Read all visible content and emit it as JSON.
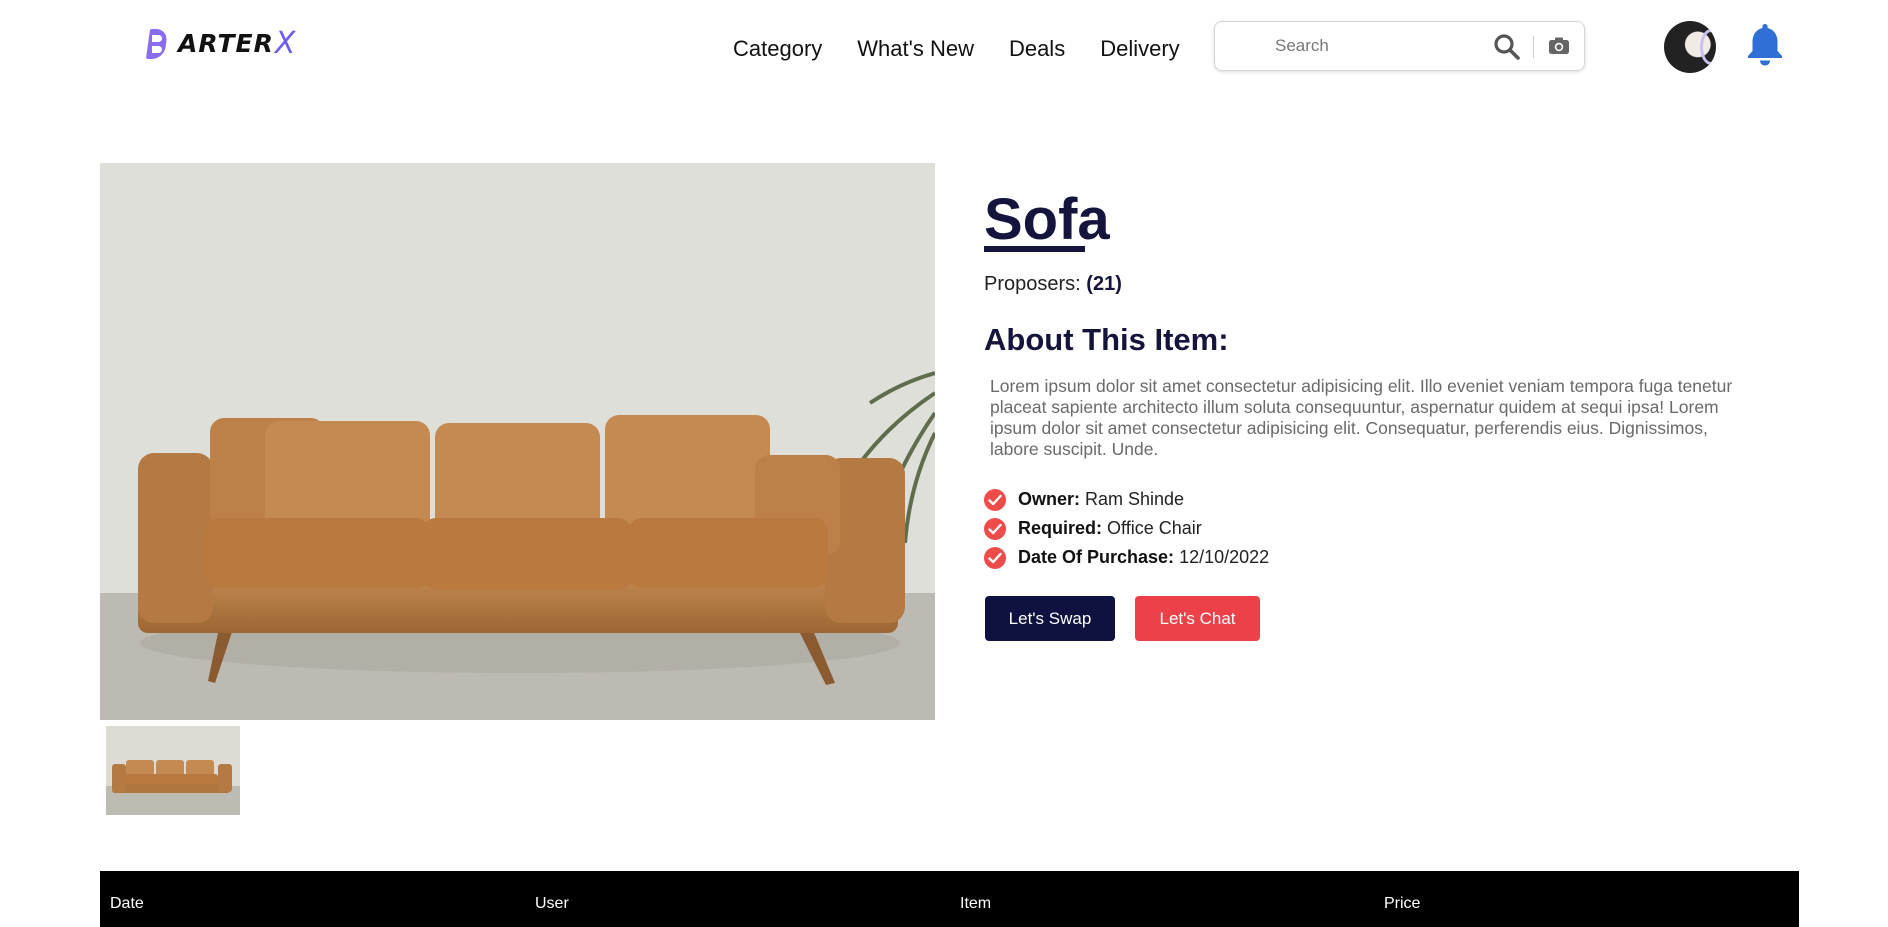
{
  "header": {
    "logo_text": "ARTER",
    "logo_x": "X",
    "nav": [
      "Category",
      "What's New",
      "Deals",
      "Delivery"
    ],
    "search_placeholder": "Search"
  },
  "product": {
    "title": "Sofa",
    "proposers_label": "Proposers:",
    "proposers_count": "(21)",
    "about_heading": "About This Item:",
    "description": "Lorem ipsum dolor sit amet consectetur adipisicing elit. Illo eveniet veniam tempora fuga tenetur placeat sapiente architecto illum soluta consequuntur, aspernatur quidem at sequi ipsa! Lorem ipsum dolor sit amet consectetur adipisicing elit. Consequatur, perferendis eius. Dignissimos, labore suscipit. Unde.",
    "facts": [
      {
        "label": "Owner:",
        "value": "Ram Shinde"
      },
      {
        "label": "Required:",
        "value": "Office Chair"
      },
      {
        "label": "Date Of Purchase:",
        "value": "12/10/2022"
      }
    ],
    "swap_button": "Let's Swap",
    "chat_button": "Let's Chat"
  },
  "table": {
    "columns": [
      "Date",
      "User",
      "Item",
      "Price"
    ]
  },
  "colors": {
    "navy": "#14143d",
    "accent_red": "#ee4049",
    "logo_purple": "#6b5cf2",
    "bell_blue": "#2f6fd6"
  }
}
